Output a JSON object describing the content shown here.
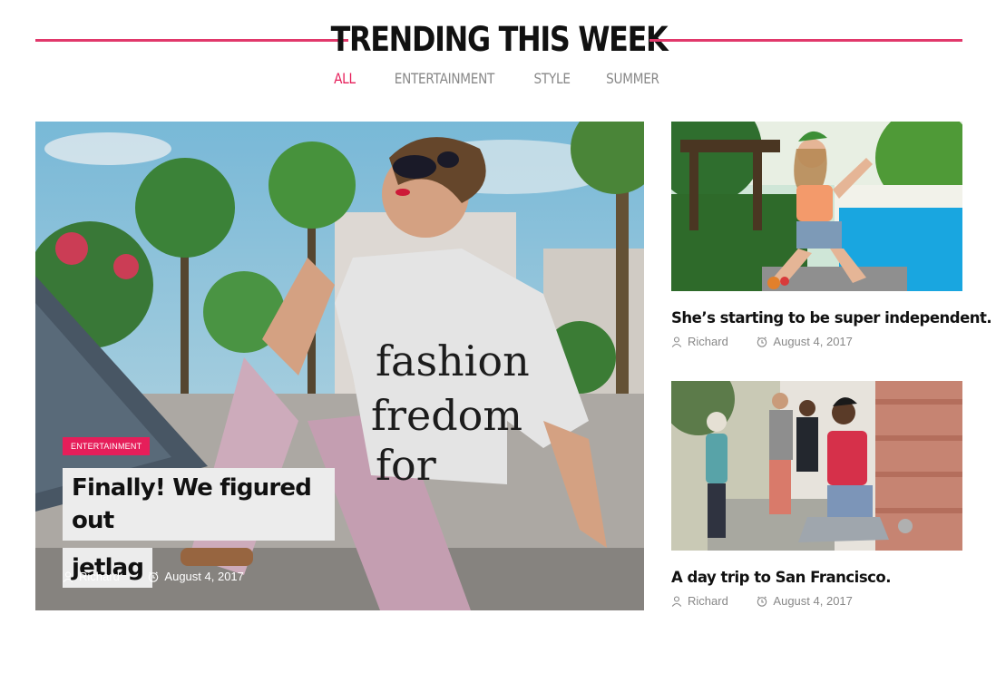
{
  "section": {
    "title": "TRENDING THIS WEEK",
    "tabs": [
      "ALL",
      "ENTERTAINMENT",
      "STYLE",
      "SUMMER"
    ],
    "active_tab": "ALL"
  },
  "featured": {
    "category": "ENTERTAINMENT",
    "title_lines": [
      "Finally! We figured out",
      "jetlag"
    ],
    "author": "Richard",
    "date": "August 4, 2017",
    "shirt_text": [
      "fashion",
      "fredom",
      "for"
    ]
  },
  "posts": [
    {
      "title": "She’s starting to be super independent.",
      "author": "Richard",
      "date": "August 4, 2017"
    },
    {
      "title": "A day trip to San Francisco.",
      "author": "Richard",
      "date": "August 4, 2017"
    }
  ],
  "colors": {
    "accent": "#e61e5a",
    "rule": "#e1386b",
    "meta": "#888888"
  }
}
